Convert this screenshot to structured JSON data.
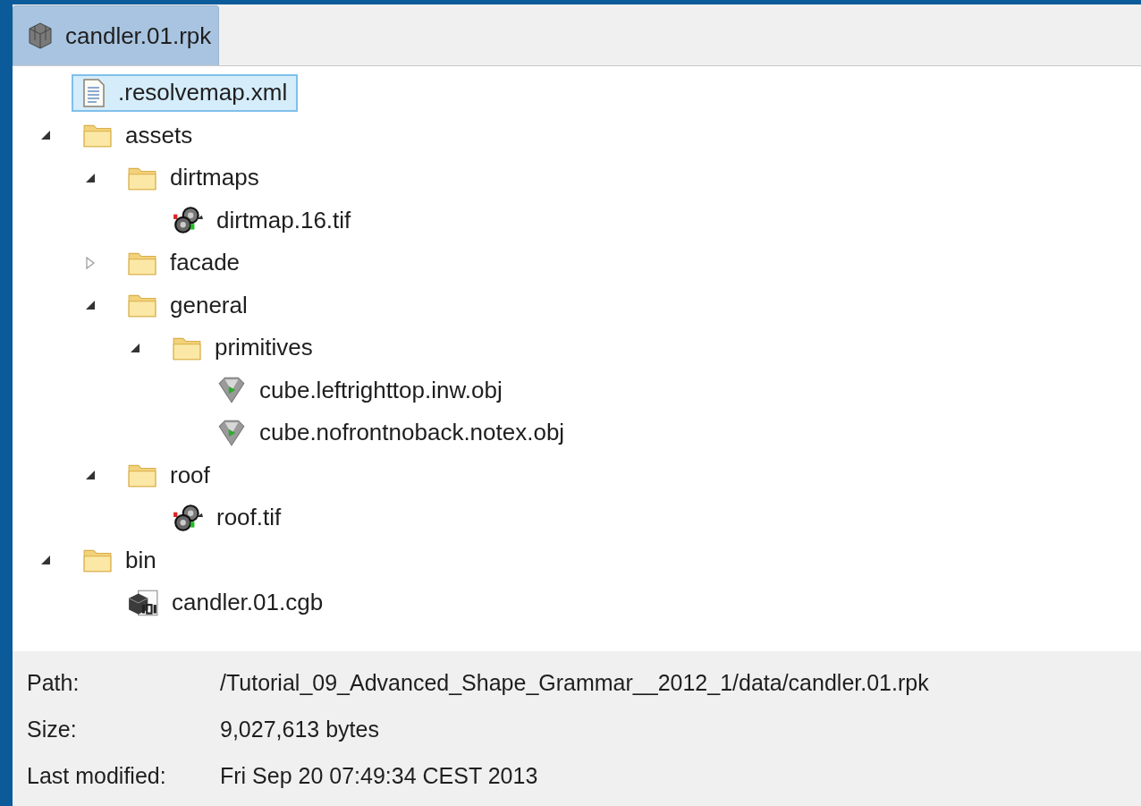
{
  "tab": {
    "label": "candler.01.rpk",
    "selected": true
  },
  "tree": [
    {
      "kind": "xml",
      "label": ".resolvemap.xml",
      "selected": true
    },
    {
      "kind": "folder",
      "label": "assets",
      "expanded": true,
      "selected": false,
      "children": [
        {
          "kind": "folder",
          "label": "dirtmaps",
          "expanded": true,
          "selected": false,
          "children": [
            {
              "kind": "texture",
              "label": "dirtmap.16.tif",
              "selected": false
            }
          ]
        },
        {
          "kind": "folder",
          "label": "facade",
          "expanded": false,
          "selected": false
        },
        {
          "kind": "folder",
          "label": "general",
          "expanded": true,
          "selected": false,
          "children": [
            {
              "kind": "folder",
              "label": "primitives",
              "expanded": true,
              "selected": false,
              "children": [
                {
                  "kind": "mesh",
                  "label": "cube.leftrighttop.inw.obj",
                  "selected": false
                },
                {
                  "kind": "mesh",
                  "label": "cube.nofrontnoback.notex.obj",
                  "selected": false
                }
              ]
            }
          ]
        },
        {
          "kind": "folder",
          "label": "roof",
          "expanded": true,
          "selected": false,
          "children": [
            {
              "kind": "texture",
              "label": "roof.tif",
              "selected": false
            }
          ]
        }
      ]
    },
    {
      "kind": "folder",
      "label": "bin",
      "expanded": true,
      "selected": false,
      "children": [
        {
          "kind": "binary",
          "label": "candler.01.cgb",
          "selected": false
        }
      ]
    }
  ],
  "info": [
    {
      "label": "Path:",
      "value": "/Tutorial_09_Advanced_Shape_Grammar__2012_1/data/candler.01.rpk"
    },
    {
      "label": "Size:",
      "value": "9,027,613 bytes"
    },
    {
      "label": "Last modified:",
      "value": "Fri Sep 20 07:49:34 CEST 2013"
    }
  ]
}
